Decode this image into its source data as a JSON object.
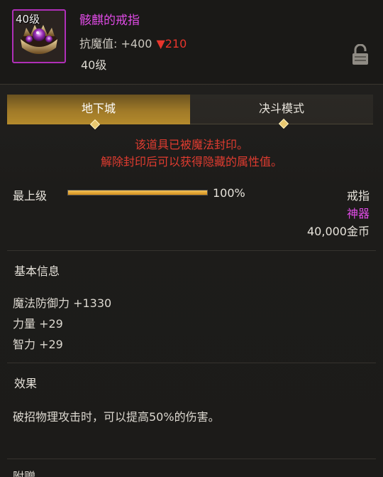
{
  "header": {
    "icon_level": "40级",
    "item_name": "骸麒的戒指",
    "stat_label": "抗魔值: +400",
    "stat_down": "▼210",
    "level": "40级"
  },
  "tabs": [
    {
      "label": "地下城",
      "active": true
    },
    {
      "label": "决斗模式",
      "active": false
    }
  ],
  "seal_message": {
    "line1": "该道具已被魔法封印。",
    "line2": "解除封印后可以获得隐藏的属性值。"
  },
  "grade": {
    "label": "最上级",
    "progress_percent": 100,
    "percent_text": "100%"
  },
  "item_info": {
    "type": "戒指",
    "rarity": "神器",
    "price": "40,000金币"
  },
  "basic_info": {
    "title": "基本信息",
    "stats": [
      "魔法防御力 +1330",
      "力量 +29",
      "智力 +29"
    ]
  },
  "effect": {
    "title": "效果",
    "text": "破招物理攻击时，可以提高50%的伤害。"
  },
  "next_section_title": "附赠",
  "colors": {
    "item_name": "#e04be6",
    "rarity": "#e04be6",
    "seal_text": "#e03c30",
    "stat_down": "#e8352c",
    "tab_active": "#a07a28",
    "icon_border": "#b02fb8"
  }
}
